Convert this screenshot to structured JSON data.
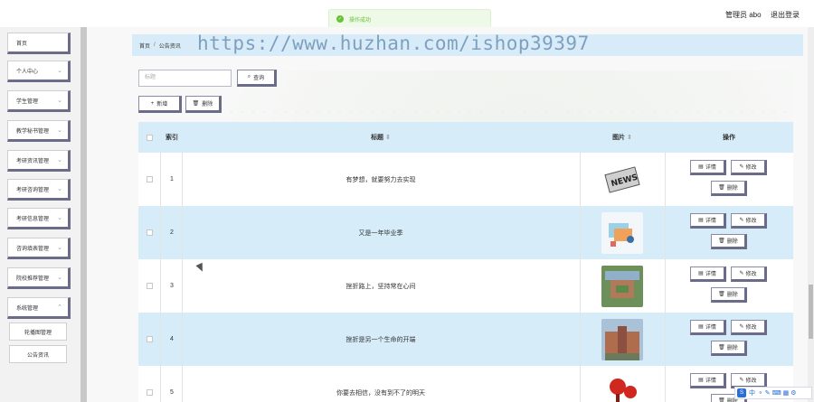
{
  "toast": {
    "text": "操作成功",
    "icon": "check-circle-icon",
    "color": "#67c23a"
  },
  "header": {
    "admin_label": "管理员 abo",
    "logout_label": "退出登录"
  },
  "sidebar": {
    "items": [
      {
        "label": "首页",
        "has_children": false
      },
      {
        "label": "个人中心",
        "has_children": true
      },
      {
        "label": "学生管理",
        "has_children": true
      },
      {
        "label": "教学秘书管理",
        "has_children": true
      },
      {
        "label": "考研资讯管理",
        "has_children": true
      },
      {
        "label": "考研咨询管理",
        "has_children": true
      },
      {
        "label": "考研信息管理",
        "has_children": true
      },
      {
        "label": "咨询填表管理",
        "has_children": true
      },
      {
        "label": "院校推荐管理",
        "has_children": true
      },
      {
        "label": "系统管理",
        "has_children": true
      }
    ],
    "subitems": [
      {
        "label": "轮播图管理"
      },
      {
        "label": "公告资讯"
      }
    ]
  },
  "breadcrumb": {
    "home": "首页",
    "separator": "/",
    "current": "公告资讯"
  },
  "watermark": "https://www.huzhan.com/ishop39397",
  "search": {
    "placeholder": "标题",
    "button_label": "查询"
  },
  "toolbar": {
    "add_label": "新增",
    "delete_label": "删除"
  },
  "table": {
    "headers": {
      "index": "索引",
      "title": "标题",
      "image": "图片",
      "actions": "操作",
      "sort_icon": "sort-icon"
    },
    "actions": {
      "detail": "详情",
      "edit": "修改",
      "delete": "删除"
    },
    "rows": [
      {
        "index": "1",
        "title": "有梦想，就要努力去实现",
        "image": "news-paper-thumbnail"
      },
      {
        "index": "2",
        "title": "又是一年毕业季",
        "image": "graduation-illustration-thumbnail"
      },
      {
        "index": "3",
        "title": "挫折路上，坚持常在心间",
        "image": "campus-aerial-thumbnail"
      },
      {
        "index": "4",
        "title": "挫折是另一个生命的开端",
        "image": "campus-building-thumbnail"
      },
      {
        "index": "5",
        "title": "你要去相信，没有到不了的明天",
        "image": "red-microphone-thumbnail"
      }
    ]
  },
  "ime": {
    "mode": "中"
  }
}
